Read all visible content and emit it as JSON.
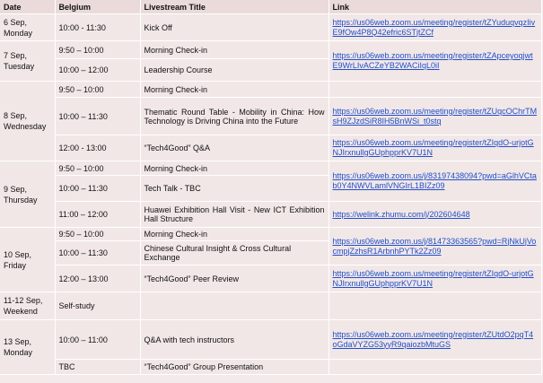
{
  "headers": [
    "Date",
    "Belgium",
    "Livestream Title",
    "Link"
  ],
  "groups": [
    {
      "date": "6 Sep, Monday",
      "rows": [
        {
          "time": "10:00 - 11:30",
          "title": "Kick Off",
          "link": "https://us06web.zoom.us/meeting/register/tZYuduqvqzIivE9fOw4P8Q42efric6STjtZCf"
        }
      ]
    },
    {
      "date": "7 Sep, Tuesday",
      "rows": [
        {
          "time": "9:50 – 10:00",
          "title": "Morning Check-in",
          "link": "https://us06web.zoom.us/meeting/register/tZApceyoqjwtE9WrLIvACZeYB2WACiIqL0iI"
        },
        {
          "time": "10:00 – 12:00",
          "title": "Leadership Course",
          "link": ""
        }
      ]
    },
    {
      "date": "8 Sep, Wednesday",
      "rows": [
        {
          "time": "9:50 – 10:00",
          "title": "Morning Check-in",
          "link": ""
        },
        {
          "time": "10:00 – 11:30",
          "title": "Thematic Round Table - Mobility in China: How Technology is Driving China into the Future",
          "link": "https://us06web.zoom.us/meeting/register/tZUqcOChrTMsH9ZJzdSiR8IH5BnWSi_t0stq"
        },
        {
          "time": "12:00 - 13:00",
          "title": "“Tech4Good” Q&A",
          "link": "https://us06web.zoom.us/meeting/register/tZIqdO-urjotGNJIrxnullgGUphpprKV7U1N"
        }
      ]
    },
    {
      "date": "9 Sep, Thursday",
      "rows": [
        {
          "time": "9:50 – 10:00",
          "title": "Morning Check-in",
          "link": ""
        },
        {
          "time": "10:00 – 11:30",
          "title": "Tech Talk - TBC",
          "link": "https://us06web.zoom.us/j/83197438094?pwd=aGlhVCtab0Y4NWVLamlVNGIrL1BIZz09"
        },
        {
          "time": "11:00 – 12:00",
          "title": "Huawei Exhibition Hall Visit - New ICT Exhibition Hall Structure",
          "link": "https://welink.zhumu.com/j/202604648"
        }
      ]
    },
    {
      "date": "10 Sep, Friday",
      "rows": [
        {
          "time": "9:50 – 10:00",
          "title": "Morning Check-in",
          "link": "https://us06web.zoom.us/j/81473363565?pwd=RjNkUjVocmpjZzhsR1ArbnhPYTk2Zz09"
        },
        {
          "time": "10:00 – 11:30",
          "title": "Chinese Cultural Insight & Cross Cultural Exchange",
          "link": ""
        },
        {
          "time": "12:00 – 13:00",
          "title": "“Tech4Good” Peer Review",
          "link": "https://us06web.zoom.us/meeting/register/tZIqdO-urjotGNJIrxnullgGUphpprKV7U1N"
        }
      ]
    },
    {
      "date": "11-12 Sep, Weekend",
      "rows": [
        {
          "time": "Self-study",
          "title": "",
          "link": ""
        }
      ]
    },
    {
      "date": "13 Sep, Monday",
      "rows": [
        {
          "time": "10:00 – 11:00",
          "title": "Q&A with tech instructors",
          "link": "https://us06web.zoom.us/meeting/register/tZUtdO2pqT4oGdaVYZG53yyR9qaiozbMtuGS"
        },
        {
          "time": "TBC",
          "title": "“Tech4Good” Group Presentation",
          "link": ""
        }
      ]
    }
  ]
}
